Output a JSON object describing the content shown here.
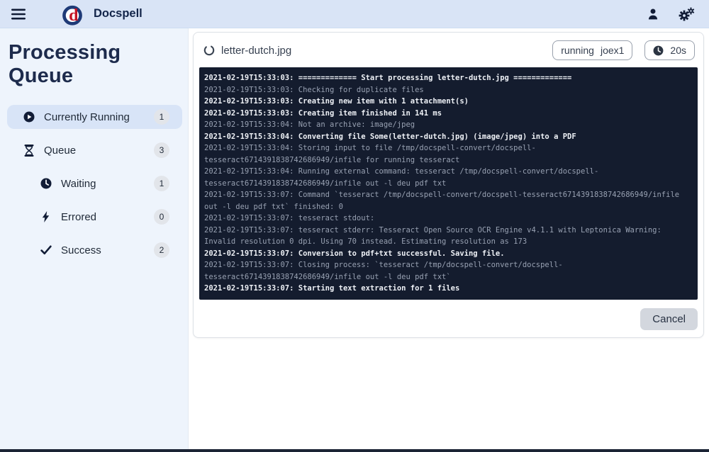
{
  "topbar": {
    "brand": "Docspell"
  },
  "sidebar": {
    "title": "Processing Queue",
    "items": [
      {
        "label": "Currently Running",
        "count": "1",
        "icon": "play-circle-icon",
        "active": true,
        "sub": false
      },
      {
        "label": "Queue",
        "count": "3",
        "icon": "hourglass-icon",
        "active": false,
        "sub": false
      },
      {
        "label": "Waiting",
        "count": "1",
        "icon": "clock-icon",
        "active": false,
        "sub": true
      },
      {
        "label": "Errored",
        "count": "0",
        "icon": "bolt-icon",
        "active": false,
        "sub": true
      },
      {
        "label": "Success",
        "count": "2",
        "icon": "check-icon",
        "active": false,
        "sub": true
      }
    ]
  },
  "job": {
    "filename": "letter-dutch.jpg",
    "state": "running",
    "worker": "joex1",
    "duration": "20s",
    "cancel_label": "Cancel"
  },
  "colors": {
    "topbar_bg": "#d9e4f6",
    "sidebar_bg": "#eef4fc",
    "active_item_bg": "#d8e4f7",
    "console_bg": "#141c2e",
    "console_dim_text": "#98a1b2",
    "console_bright_text": "#eef1f6",
    "brand_navy": "#13254a",
    "logo_red": "#c41425"
  },
  "console": {
    "lines": [
      {
        "time": "2021-02-19T15:33:03",
        "text": "============= Start processing letter-dutch.jpg =============",
        "level": "info"
      },
      {
        "time": "2021-02-19T15:33:03",
        "text": "Checking for duplicate files",
        "level": "debug"
      },
      {
        "time": "2021-02-19T15:33:03",
        "text": "Creating new item with 1 attachment(s)",
        "level": "info"
      },
      {
        "time": "2021-02-19T15:33:03",
        "text": "Creating item finished in 141 ms",
        "level": "info"
      },
      {
        "time": "2021-02-19T15:33:04",
        "text": "Not an archive: image/jpeg",
        "level": "debug"
      },
      {
        "time": "2021-02-19T15:33:04",
        "text": "Converting file Some(letter-dutch.jpg) (image/jpeg) into a PDF",
        "level": "info"
      },
      {
        "time": "2021-02-19T15:33:04",
        "text": "Storing input to file /tmp/docspell-convert/docspell-tesseract6714391838742686949/infile for running tesseract",
        "level": "debug"
      },
      {
        "time": "2021-02-19T15:33:04",
        "text": "Running external command: tesseract /tmp/docspell-convert/docspell-tesseract6714391838742686949/infile out -l deu pdf txt",
        "level": "debug"
      },
      {
        "time": "2021-02-19T15:33:07",
        "text": "Command `tesseract /tmp/docspell-convert/docspell-tesseract6714391838742686949/infile out -l deu pdf txt` finished: 0",
        "level": "debug"
      },
      {
        "time": "2021-02-19T15:33:07",
        "text": "tesseract stdout:",
        "level": "debug"
      },
      {
        "time": "2021-02-19T15:33:07",
        "text": "tesseract stderr: Tesseract Open Source OCR Engine v4.1.1 with Leptonica Warning: Invalid resolution 0 dpi. Using 70 instead. Estimating resolution as 173",
        "level": "debug"
      },
      {
        "time": "2021-02-19T15:33:07",
        "text": "Conversion to pdf+txt successful. Saving file.",
        "level": "info"
      },
      {
        "time": "2021-02-19T15:33:07",
        "text": "Closing process: `tesseract /tmp/docspell-convert/docspell-tesseract6714391838742686949/infile out -l deu pdf txt`",
        "level": "debug"
      },
      {
        "time": "2021-02-19T15:33:07",
        "text": "Starting text extraction for 1 files",
        "level": "info"
      }
    ]
  }
}
